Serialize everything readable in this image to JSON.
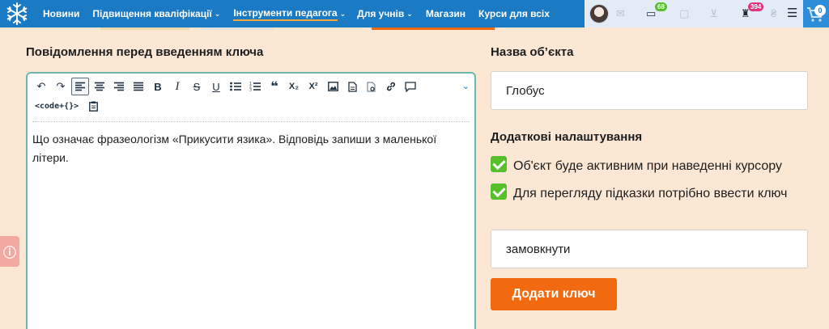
{
  "header": {
    "nav": [
      {
        "label": "Новини",
        "has_dropdown": false
      },
      {
        "label": "Підвищення кваліфікації",
        "has_dropdown": true
      },
      {
        "label": "Інструменти педагога",
        "has_dropdown": true,
        "active": true
      },
      {
        "label": "Для учнів",
        "has_dropdown": true
      },
      {
        "label": "Магазин",
        "has_dropdown": false
      },
      {
        "label": "Курси для всіх",
        "has_dropdown": false
      }
    ],
    "messages_badge": "68",
    "achievements_badge": "394",
    "cart_count": "0",
    "icons": [
      "snowflake-logo-icon",
      "mail-icon",
      "chat-icon",
      "bookmark-icon",
      "cart-icon",
      "trophy-icon",
      "currency-icon",
      "menu-icon"
    ]
  },
  "editor_section": {
    "title": "Повідомлення перед введенням ключа",
    "toolbar_code_label": "<code+{}>",
    "content": "Що означає фразеологізм «Прикусити язика». Відповідь запиши з маленької літери."
  },
  "object_section": {
    "title": "Назва об’єкта",
    "object_name": "Глобус"
  },
  "settings_section": {
    "title": "Додаткові налаштування",
    "options": [
      {
        "label": "Об'єкт буде активним при наведенні курсору",
        "checked": true
      },
      {
        "label": "Для перегляду підказки потрібно ввести ключ",
        "checked": true
      }
    ],
    "key_value": "замовкнути",
    "add_key_button": "Додати ключ"
  },
  "colors": {
    "header_bg": "#1b7ac4",
    "page_bg": "#fbe7d3",
    "accent_orange": "#f26a10",
    "check_green": "#56c02b",
    "editor_border": "#6bb7b0"
  }
}
